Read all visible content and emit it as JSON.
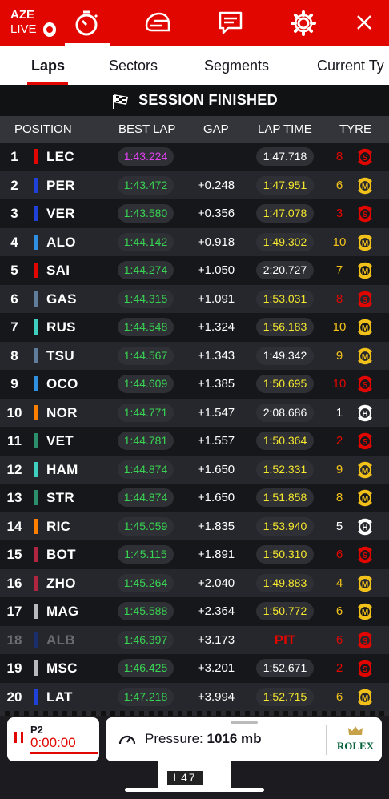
{
  "header": {
    "race_code": "AZE",
    "live_label": "LIVE",
    "close_icon": "close-icon"
  },
  "tabs": [
    {
      "label": "Laps",
      "active": true
    },
    {
      "label": "Sectors"
    },
    {
      "label": "Segments"
    },
    {
      "label": "Current Ty"
    }
  ],
  "status_text": "SESSION FINISHED",
  "columns": {
    "position": "POSITION",
    "best_lap": "BEST LAP",
    "gap": "GAP",
    "lap_time": "LAP TIME",
    "tyre": "TYRE"
  },
  "colors": {
    "red": "#e10600",
    "purple": "#e041ef",
    "green": "#39d353",
    "yellow": "#f5e82e",
    "soft": "#e10600",
    "medium": "#f2c21b",
    "hard": "#ffffff"
  },
  "rows": [
    {
      "pos": "1",
      "code": "LEC",
      "team_color": "#e10600",
      "best": "1:43.224",
      "best_color": "purple",
      "gap": "",
      "lap": "1:47.718",
      "lap_color": "white",
      "laps": "8",
      "tyre": "S"
    },
    {
      "pos": "2",
      "code": "PER",
      "team_color": "#1e41d8",
      "best": "1:43.472",
      "best_color": "green",
      "gap": "+0.248",
      "lap": "1:47.951",
      "lap_color": "yellow",
      "laps": "6",
      "tyre": "M"
    },
    {
      "pos": "3",
      "code": "VER",
      "team_color": "#1e41d8",
      "best": "1:43.580",
      "best_color": "green",
      "gap": "+0.356",
      "lap": "1:47.078",
      "lap_color": "yellow",
      "laps": "3",
      "tyre": "S"
    },
    {
      "pos": "4",
      "code": "ALO",
      "team_color": "#2f8fe0",
      "best": "1:44.142",
      "best_color": "green",
      "gap": "+0.918",
      "lap": "1:49.302",
      "lap_color": "yellow",
      "laps": "10",
      "tyre": "M"
    },
    {
      "pos": "5",
      "code": "SAI",
      "team_color": "#e10600",
      "best": "1:44.274",
      "best_color": "green",
      "gap": "+1.050",
      "lap": "2:20.727",
      "lap_color": "white",
      "laps": "7",
      "tyre": "M"
    },
    {
      "pos": "6",
      "code": "GAS",
      "team_color": "#5f7c9a",
      "best": "1:44.315",
      "best_color": "green",
      "gap": "+1.091",
      "lap": "1:53.031",
      "lap_color": "yellow",
      "laps": "8",
      "tyre": "S"
    },
    {
      "pos": "7",
      "code": "RUS",
      "team_color": "#3ecfc0",
      "best": "1:44.548",
      "best_color": "green",
      "gap": "+1.324",
      "lap": "1:56.183",
      "lap_color": "yellow",
      "laps": "10",
      "tyre": "M"
    },
    {
      "pos": "8",
      "code": "TSU",
      "team_color": "#5f7c9a",
      "best": "1:44.567",
      "best_color": "green",
      "gap": "+1.343",
      "lap": "1:49.342",
      "lap_color": "white",
      "laps": "9",
      "tyre": "M"
    },
    {
      "pos": "9",
      "code": "OCO",
      "team_color": "#2f8fe0",
      "best": "1:44.609",
      "best_color": "green",
      "gap": "+1.385",
      "lap": "1:50.695",
      "lap_color": "yellow",
      "laps": "10",
      "tyre": "S"
    },
    {
      "pos": "10",
      "code": "NOR",
      "team_color": "#ff8000",
      "best": "1:44.771",
      "best_color": "green",
      "gap": "+1.547",
      "lap": "2:08.686",
      "lap_color": "white",
      "laps": "1",
      "tyre": "H"
    },
    {
      "pos": "11",
      "code": "VET",
      "team_color": "#2a8f6a",
      "best": "1:44.781",
      "best_color": "green",
      "gap": "+1.557",
      "lap": "1:50.364",
      "lap_color": "yellow",
      "laps": "2",
      "tyre": "S"
    },
    {
      "pos": "12",
      "code": "HAM",
      "team_color": "#3ecfc0",
      "best": "1:44.874",
      "best_color": "green",
      "gap": "+1.650",
      "lap": "1:52.331",
      "lap_color": "yellow",
      "laps": "9",
      "tyre": "M"
    },
    {
      "pos": "13",
      "code": "STR",
      "team_color": "#2a8f6a",
      "best": "1:44.874",
      "best_color": "green",
      "gap": "+1.650",
      "lap": "1:51.858",
      "lap_color": "yellow",
      "laps": "8",
      "tyre": "M"
    },
    {
      "pos": "14",
      "code": "RIC",
      "team_color": "#ff8000",
      "best": "1:45.059",
      "best_color": "green",
      "gap": "+1.835",
      "lap": "1:53.940",
      "lap_color": "yellow",
      "laps": "5",
      "tyre": "H"
    },
    {
      "pos": "15",
      "code": "BOT",
      "team_color": "#b0253f",
      "best": "1:45.115",
      "best_color": "green",
      "gap": "+1.891",
      "lap": "1:50.310",
      "lap_color": "yellow",
      "laps": "6",
      "tyre": "S"
    },
    {
      "pos": "16",
      "code": "ZHO",
      "team_color": "#b0253f",
      "best": "1:45.264",
      "best_color": "green",
      "gap": "+2.040",
      "lap": "1:49.883",
      "lap_color": "yellow",
      "laps": "4",
      "tyre": "M"
    },
    {
      "pos": "17",
      "code": "MAG",
      "team_color": "#b6babd",
      "best": "1:45.588",
      "best_color": "green",
      "gap": "+2.364",
      "lap": "1:50.772",
      "lap_color": "yellow",
      "laps": "6",
      "tyre": "M"
    },
    {
      "pos": "18",
      "code": "ALB",
      "team_color": "#1a2e6c",
      "best": "1:46.397",
      "best_color": "green",
      "gap": "+3.173",
      "lap": "PIT",
      "lap_color": "pit",
      "laps": "6",
      "tyre": "S",
      "out": true
    },
    {
      "pos": "19",
      "code": "MSC",
      "team_color": "#b6babd",
      "best": "1:46.425",
      "best_color": "green",
      "gap": "+3.201",
      "lap": "1:52.671",
      "lap_color": "white",
      "laps": "2",
      "tyre": "S"
    },
    {
      "pos": "20",
      "code": "LAT",
      "team_color": "#1e41d8",
      "best": "1:47.218",
      "best_color": "green",
      "gap": "+3.994",
      "lap": "1:52.715",
      "lap_color": "yellow",
      "laps": "6",
      "tyre": "M"
    }
  ],
  "footer": {
    "session_label": "P2",
    "session_time": "0:00:00",
    "pressure_label": "Pressure:",
    "pressure_value": "1016 mb",
    "sponsor": "ROLEX",
    "car_number": "L47"
  }
}
